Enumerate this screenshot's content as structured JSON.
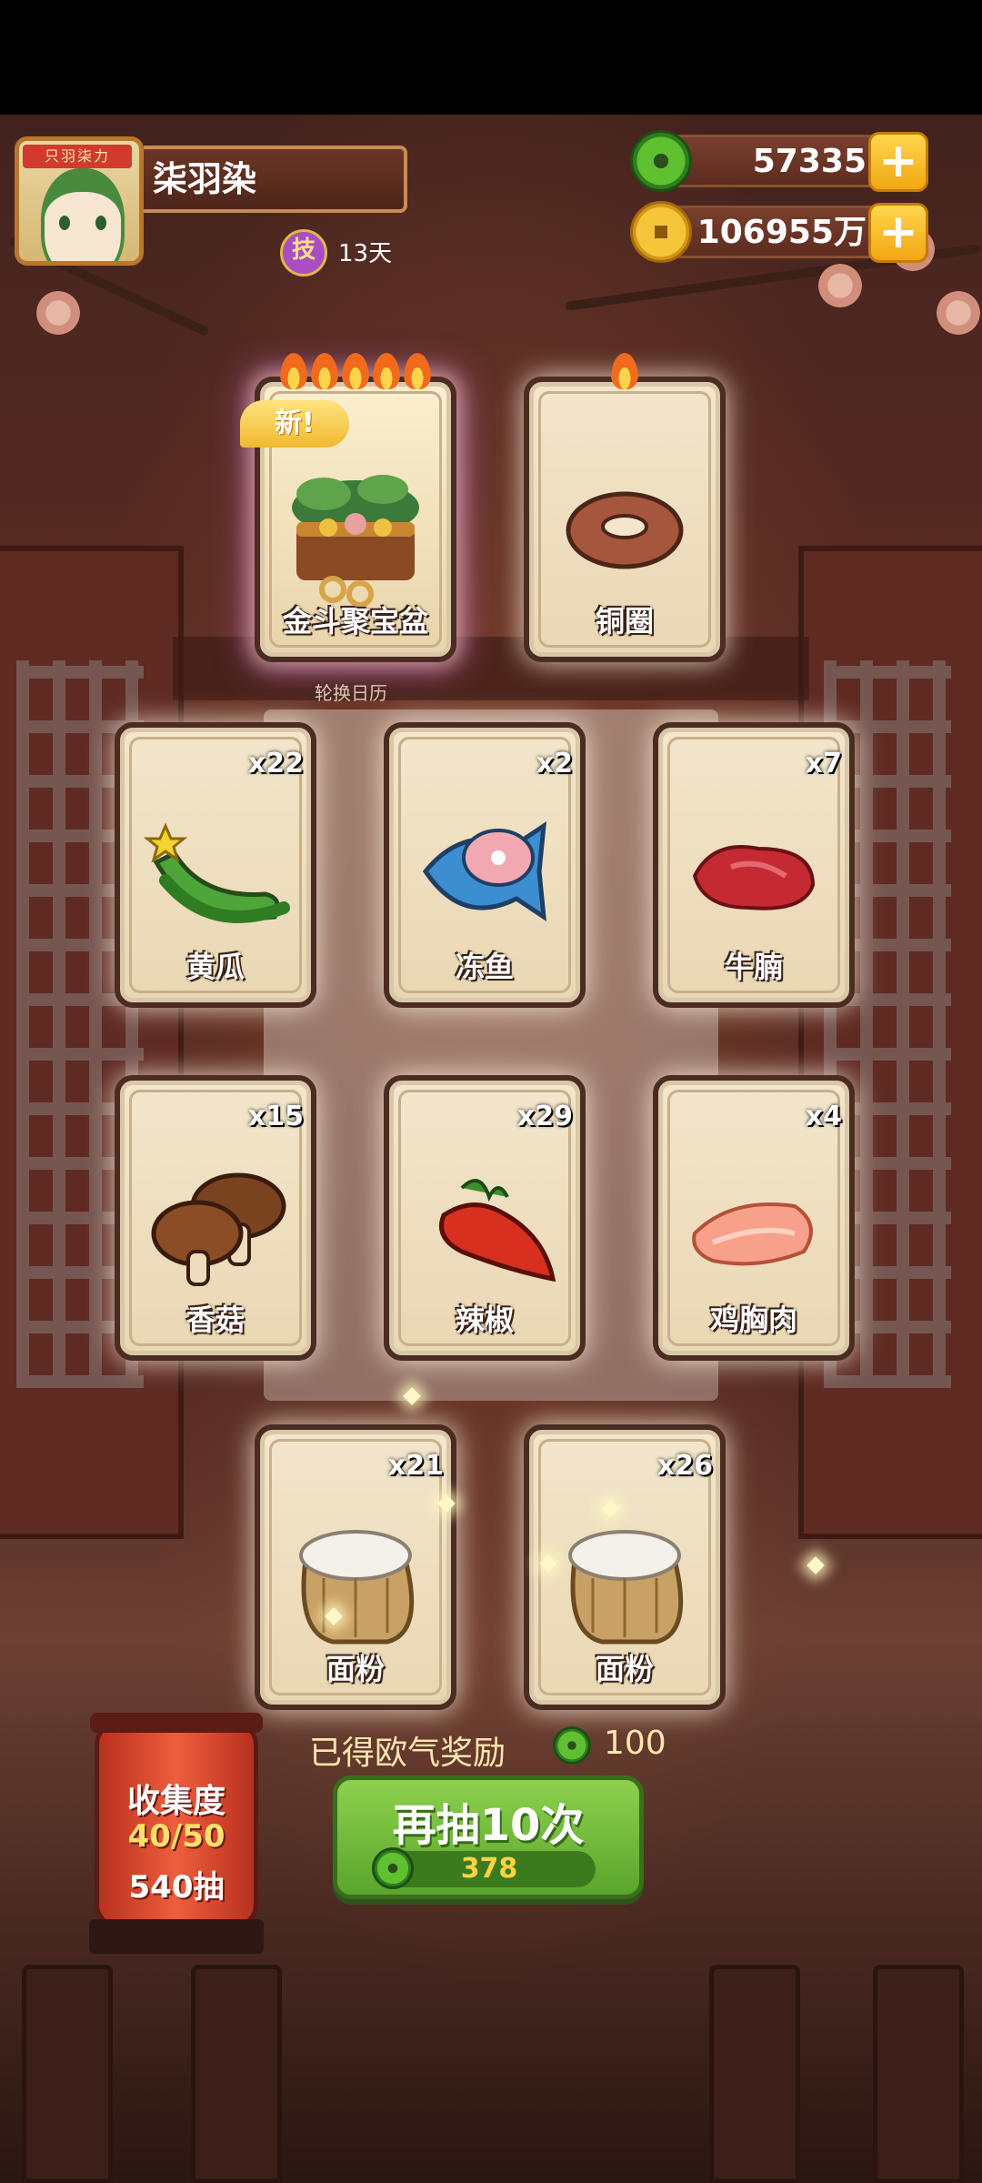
{
  "player": {
    "name": "柒羽染",
    "avatar_badge": "只羽柒力",
    "skill_badge": "技",
    "skill_days": "13天"
  },
  "currencies": {
    "jade": "57335",
    "coins": "106955万",
    "plus_label": "+"
  },
  "featured_cards": [
    {
      "name": "金斗聚宝盆",
      "new_label": "新!",
      "flames": 5,
      "art": "treasure-bowl"
    },
    {
      "name": "铜圈",
      "flames": 1,
      "art": "copper-ring"
    }
  ],
  "calendar_label": "轮换日历",
  "cards": [
    {
      "name": "黄瓜",
      "count": "x22",
      "art": "cucumber"
    },
    {
      "name": "冻鱼",
      "count": "x2",
      "art": "frozen-fish"
    },
    {
      "name": "牛腩",
      "count": "x7",
      "art": "beef-brisket"
    },
    {
      "name": "香菇",
      "count": "x15",
      "art": "shiitake"
    },
    {
      "name": "辣椒",
      "count": "x29",
      "art": "chili"
    },
    {
      "name": "鸡胸肉",
      "count": "x4",
      "art": "chicken-breast"
    },
    {
      "name": "面粉",
      "count": "x21",
      "art": "flour-sack"
    },
    {
      "name": "面粉",
      "count": "x26",
      "art": "flour-sack"
    }
  ],
  "collection": {
    "title": "收集度",
    "progress": "40/50",
    "draws": "540抽"
  },
  "reward": {
    "label": "已得欧气奖励",
    "value": "100"
  },
  "redraw": {
    "label": "再抽10次",
    "cost": "378"
  },
  "colors": {
    "accent_green": "#5aa52c",
    "gold": "#f2a712",
    "lantern_red": "#ef5e3c"
  }
}
